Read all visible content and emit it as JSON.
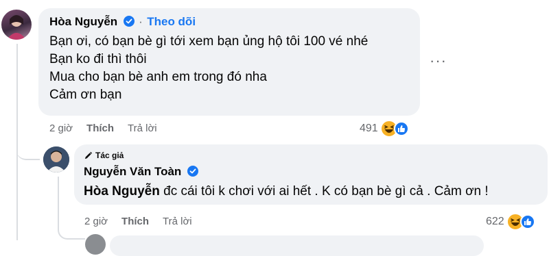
{
  "comment1": {
    "author": "Hòa Nguyễn",
    "separator": "·",
    "follow_label": "Theo dõi",
    "lines": [
      "Bạn ơi, có bạn bè gì tới xem bạn ủng hộ tôi 100 vé nhé",
      "Bạn ko đi thì thôi",
      "Mua cho bạn bè anh em trong đó nha",
      "Cảm ơn bạn"
    ],
    "more_label": "···",
    "time": "2 giờ",
    "like_label": "Thích",
    "reply_label": "Trả lời",
    "reaction_count": "491",
    "reaction_icons": [
      "haha-icon",
      "like-icon"
    ]
  },
  "reply1": {
    "author_tag": "Tác giả",
    "author": "Nguyễn Văn Toàn",
    "mention": "Hòa Nguyễn",
    "text": " đc cái tôi k chơi với ai hết . K có bạn bè gì cả . Cảm ơn !",
    "time": "2 giờ",
    "like_label": "Thích",
    "reply_label": "Trả lời",
    "reaction_count": "622",
    "reaction_icons": [
      "haha-icon",
      "like-icon"
    ]
  },
  "colors": {
    "bubble": "#f0f2f5",
    "link": "#1877f2",
    "secondary_text": "#65676b",
    "haha": "#f7b125",
    "like": "#1877f2"
  }
}
